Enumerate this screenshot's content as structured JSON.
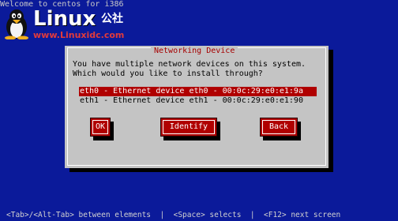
{
  "top_line": "Welcome to centos for i386",
  "logo": {
    "word": "Linux",
    "cn": "公社",
    "url": "www.Linuxidc.com"
  },
  "dialog": {
    "title": "Networking Device",
    "prompt_line1": "You have multiple network devices on this system.",
    "prompt_line2": "Which would you like to install through?",
    "devices": [
      {
        "label": "eth0 - Ethernet device eth0 - 00:0c:29:e0:e1:9a",
        "selected": true
      },
      {
        "label": "eth1 - Ethernet device eth1 - 00:0c:29:e0:e1:90",
        "selected": false
      }
    ],
    "buttons": {
      "ok": "OK",
      "identify": "Identify",
      "back": "Back"
    }
  },
  "status_bar": "<Tab>/<Alt-Tab> between elements  |  <Space> selects  |  <F12> next screen",
  "colors": {
    "background": "#0b1a9a",
    "dialog": "#c4c4c4",
    "accent": "#b00000",
    "title": "#a60000"
  }
}
